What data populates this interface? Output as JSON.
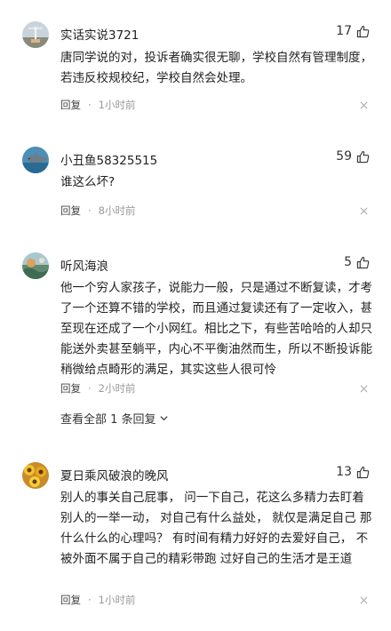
{
  "comments": [
    {
      "username": "实话实说3721",
      "likes": "17",
      "text": "唐同学说的对，投诉者确实很无聊，学校自然有管理制度，若违反校规校纪，学校自然会处理。",
      "reply_label": "回复",
      "separator": "·",
      "time": "1小时前",
      "avatar_icon": "wind-turbine-avatar"
    },
    {
      "username": "小丑鱼58325515",
      "likes": "59",
      "text": "谁这么坏?",
      "reply_label": "回复",
      "separator": "·",
      "time": "8小时前",
      "avatar_icon": "dolphin-avatar"
    },
    {
      "username": "听风海浪",
      "likes": "5",
      "text": "他一个穷人家孩子，说能力一般，只是通过不断复读，才考了一个还算不错的学校，而且通过复读还有了一定收入，甚至现在还成了一个小网红。相比之下，有些苦哈哈的人却只能送外卖甚至躺平，内心不平衡油然而生，所以不断投诉能稍微给点畸形的满足，其实这些人很可怜",
      "reply_label": "回复",
      "separator": "·",
      "time": "2小时前",
      "view_replies": "查看全部 1 条回复",
      "avatar_icon": "seascape-avatar"
    },
    {
      "username": "夏日乘风破浪的晚风",
      "likes": "13",
      "text": "别人的事关自己屁事， 问一下自己，花这么多精力去盯着别人的一举一动， 对自己有什么益处， 就仅是满足自己 那什么什么的心理吗？ 有时间有精力好好的去爱好自己， 不被外面不属于自己的精彩带跑 过好自己的生活才是王道",
      "reply_label": "回复",
      "separator": "·",
      "time": "1小时前",
      "avatar_icon": "sunflower-avatar"
    }
  ]
}
